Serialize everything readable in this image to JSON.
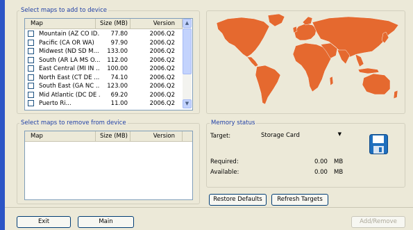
{
  "add_panel": {
    "title": "Select maps to add to device",
    "columns": {
      "map": "Map",
      "size": "Size (MB)",
      "version": "Version"
    },
    "rows": [
      {
        "map": "Mountain (AZ CO ID...",
        "size": "77.80",
        "version": "2006.Q2",
        "checked": false
      },
      {
        "map": "Pacific (CA OR WA)",
        "size": "97.90",
        "version": "2006.Q2",
        "checked": false
      },
      {
        "map": "Midwest (ND SD M...",
        "size": "133.00",
        "version": "2006.Q2",
        "checked": false
      },
      {
        "map": "South (AR LA MS O...",
        "size": "112.00",
        "version": "2006.Q2",
        "checked": false
      },
      {
        "map": "East Central  (MI IN ...",
        "size": "100.00",
        "version": "2006.Q2",
        "checked": false
      },
      {
        "map": "North East (CT DE ...",
        "size": "74.10",
        "version": "2006.Q2",
        "checked": false
      },
      {
        "map": "South East (GA NC ...",
        "size": "123.00",
        "version": "2006.Q2",
        "checked": false
      },
      {
        "map": "Mid Atlantic (DC DE ...",
        "size": "69.20",
        "version": "2006.Q2",
        "checked": false
      },
      {
        "map": "Puerto Ri...",
        "size": "11.00",
        "version": "2006.Q2",
        "checked": false
      }
    ]
  },
  "remove_panel": {
    "title": "Select maps to remove from device",
    "columns": {
      "map": "Map",
      "size": "Size (MB)",
      "version": "Version"
    }
  },
  "memory": {
    "title": "Memory status",
    "target_label": "Target:",
    "target_value": "Storage Card",
    "required_label": "Required:",
    "required_value": "0.00",
    "required_unit": "MB",
    "available_label": "Available:",
    "available_value": "0.00",
    "available_unit": "MB"
  },
  "buttons": {
    "restore_defaults": "Restore Defaults",
    "refresh_targets": "Refresh Targets",
    "exit": "Exit",
    "main": "Main",
    "add_remove": "Add/Remove"
  },
  "colors": {
    "map_land": "#e5692f",
    "accent_bar": "#2c55c6",
    "title_text": "#1f3fa6"
  },
  "icons": {
    "save": "floppy-disk-icon",
    "scroll_up": "chevron-up-icon",
    "scroll_down": "chevron-down-icon",
    "dropdown": "dropdown-arrow-icon"
  }
}
